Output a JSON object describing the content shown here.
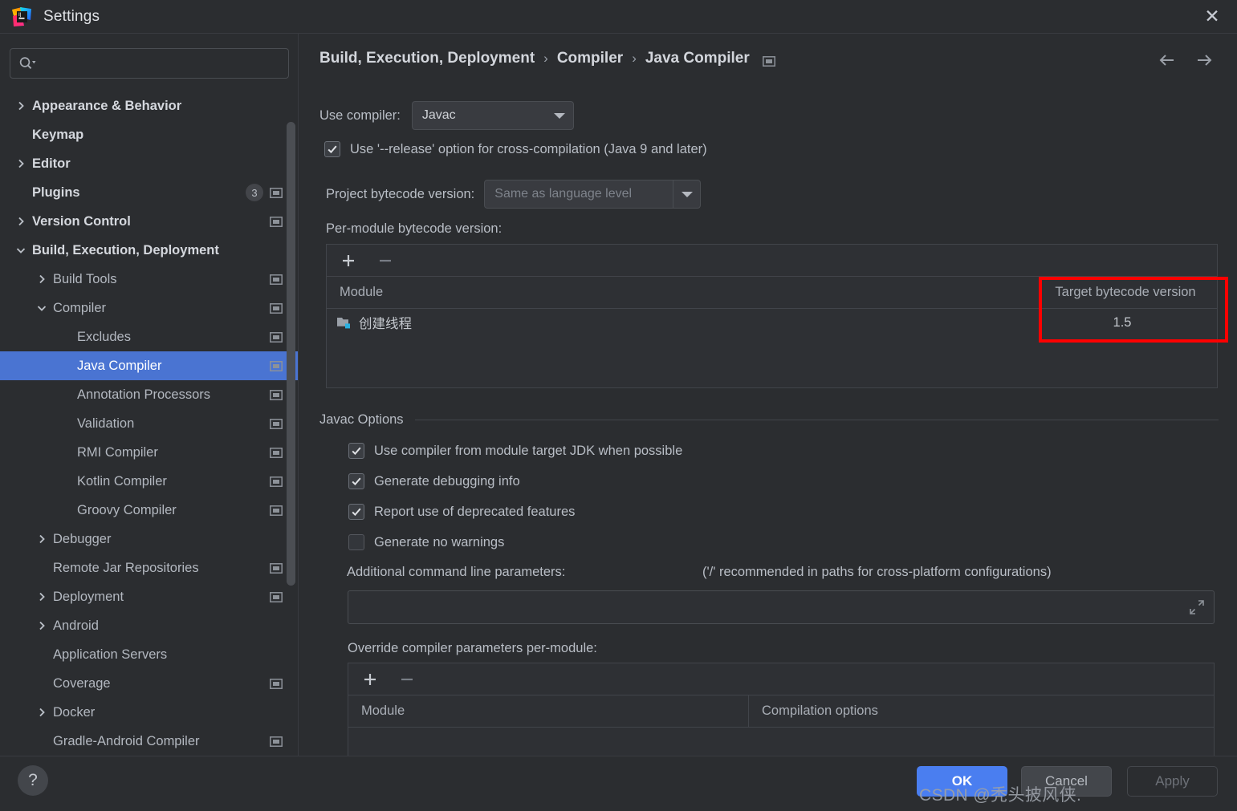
{
  "window": {
    "title": "Settings",
    "logo_icon": "intellij-idea-logo",
    "close_icon": "close-icon"
  },
  "sidebar": {
    "search": {
      "placeholder": "",
      "value": "",
      "icon": "search-icon"
    },
    "items": [
      {
        "label": "Appearance & Behavior",
        "level": 0,
        "twisty": "chevron-right",
        "scope": false,
        "badge": "",
        "selected": false
      },
      {
        "label": "Keymap",
        "level": 0,
        "twisty": "",
        "scope": false,
        "badge": "",
        "selected": false
      },
      {
        "label": "Editor",
        "level": 0,
        "twisty": "chevron-right",
        "scope": false,
        "badge": "",
        "selected": false
      },
      {
        "label": "Plugins",
        "level": 0,
        "twisty": "",
        "scope": true,
        "badge": "3",
        "selected": false
      },
      {
        "label": "Version Control",
        "level": 0,
        "twisty": "chevron-right",
        "scope": true,
        "badge": "",
        "selected": false
      },
      {
        "label": "Build, Execution, Deployment",
        "level": 0,
        "twisty": "chevron-down",
        "scope": false,
        "badge": "",
        "selected": false
      },
      {
        "label": "Build Tools",
        "level": 1,
        "twisty": "chevron-right",
        "scope": true,
        "badge": "",
        "selected": false
      },
      {
        "label": "Compiler",
        "level": 1,
        "twisty": "chevron-down",
        "scope": true,
        "badge": "",
        "selected": false
      },
      {
        "label": "Excludes",
        "level": 2,
        "twisty": "",
        "scope": true,
        "badge": "",
        "selected": false
      },
      {
        "label": "Java Compiler",
        "level": 2,
        "twisty": "",
        "scope": true,
        "badge": "",
        "selected": true
      },
      {
        "label": "Annotation Processors",
        "level": 2,
        "twisty": "",
        "scope": true,
        "badge": "",
        "selected": false
      },
      {
        "label": "Validation",
        "level": 2,
        "twisty": "",
        "scope": true,
        "badge": "",
        "selected": false
      },
      {
        "label": "RMI Compiler",
        "level": 2,
        "twisty": "",
        "scope": true,
        "badge": "",
        "selected": false
      },
      {
        "label": "Kotlin Compiler",
        "level": 2,
        "twisty": "",
        "scope": true,
        "badge": "",
        "selected": false
      },
      {
        "label": "Groovy Compiler",
        "level": 2,
        "twisty": "",
        "scope": true,
        "badge": "",
        "selected": false
      },
      {
        "label": "Debugger",
        "level": 1,
        "twisty": "chevron-right",
        "scope": false,
        "badge": "",
        "selected": false
      },
      {
        "label": "Remote Jar Repositories",
        "level": 1,
        "twisty": "",
        "scope": true,
        "badge": "",
        "selected": false
      },
      {
        "label": "Deployment",
        "level": 1,
        "twisty": "chevron-right",
        "scope": true,
        "badge": "",
        "selected": false
      },
      {
        "label": "Android",
        "level": 1,
        "twisty": "chevron-right",
        "scope": false,
        "badge": "",
        "selected": false
      },
      {
        "label": "Application Servers",
        "level": 1,
        "twisty": "",
        "scope": false,
        "badge": "",
        "selected": false
      },
      {
        "label": "Coverage",
        "level": 1,
        "twisty": "",
        "scope": true,
        "badge": "",
        "selected": false
      },
      {
        "label": "Docker",
        "level": 1,
        "twisty": "chevron-right",
        "scope": false,
        "badge": "",
        "selected": false
      },
      {
        "label": "Gradle-Android Compiler",
        "level": 1,
        "twisty": "",
        "scope": true,
        "badge": "",
        "selected": false
      }
    ]
  },
  "header": {
    "breadcrumb": [
      "Build, Execution, Deployment",
      "Compiler",
      "Java Compiler"
    ],
    "separator": "›",
    "scope_icon": "project-scope-icon",
    "back_icon": "arrow-left-icon",
    "forward_icon": "arrow-right-icon"
  },
  "main": {
    "use_compiler_label": "Use compiler:",
    "use_compiler_value": "Javac",
    "release_option_label": "Use '--release' option for cross-compilation (Java 9 and later)",
    "release_option_checked": true,
    "project_bytecode_label": "Project bytecode version:",
    "project_bytecode_value": "Same as language level",
    "per_module_label": "Per-module bytecode version:",
    "per_module_table": {
      "add_icon": "plus-icon",
      "remove_icon": "minus-icon",
      "columns": [
        "Module",
        "Target bytecode version"
      ],
      "rows": [
        {
          "module": "创建线程",
          "module_icon": "module-folder-icon",
          "target": "1.5"
        }
      ]
    },
    "javac_options_title": "Javac Options",
    "javac_options": [
      {
        "label": "Use compiler from module target JDK when possible",
        "checked": true
      },
      {
        "label": "Generate debugging info",
        "checked": true
      },
      {
        "label": "Report use of deprecated features",
        "checked": true
      },
      {
        "label": "Generate no warnings",
        "checked": false
      }
    ],
    "additional_params_label": "Additional command line parameters:",
    "additional_params_hint": "('/' recommended in paths for cross-platform configurations)",
    "additional_params_value": "",
    "additional_params_expand_icon": "expand-icon",
    "override_label": "Override compiler parameters per-module:",
    "override_table": {
      "add_icon": "plus-icon",
      "remove_icon": "minus-icon",
      "columns": [
        "Module",
        "Compilation options"
      ],
      "rows": []
    }
  },
  "annotation": {
    "color": "#fe0000"
  },
  "footer": {
    "help_label": "?",
    "ok_label": "OK",
    "cancel_label": "Cancel",
    "apply_label": "Apply"
  },
  "watermark": "CSDN @秃头披风侠."
}
